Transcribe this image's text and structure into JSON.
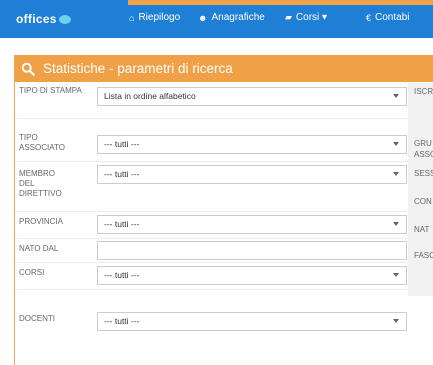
{
  "brand": {
    "text": "offices"
  },
  "nav": [
    {
      "icon": "home-icon",
      "label": "Riepilogo",
      "glyph": "⌂"
    },
    {
      "icon": "users-icon",
      "label": "Anagrafiche",
      "glyph": "☻"
    },
    {
      "icon": "book-icon",
      "label": "Corsi ▾",
      "glyph": "▰"
    },
    {
      "icon": "euro-icon",
      "label": "Contabi",
      "glyph": "€"
    }
  ],
  "panel": {
    "title": "Statistiche - parametri di ricerca"
  },
  "form": {
    "tipo_stampa": {
      "label": "TIPO DI STAMPA",
      "value": "Lista in ordine alfabetico"
    },
    "tipo_associato": {
      "label": "TIPO ASSOCIATO",
      "value": "--- tutti ---"
    },
    "membro_direttivo": {
      "label": "MEMBRO DEL DIRETTIVO",
      "value": "--- tutti ---"
    },
    "provincia": {
      "label": "PROVINCIA",
      "value": "--- tutti ---"
    },
    "nato_dal": {
      "label": "NATO DAL",
      "value": ""
    },
    "corsi": {
      "label": "CORSI",
      "value": "--- tutti ---"
    },
    "docenti": {
      "label": "DOCENTI",
      "value": "--- tutti ---"
    }
  },
  "right_labels": [
    "ISCR",
    "GRU",
    "ASSO",
    "SESS",
    "CON",
    "NAT",
    "FASC"
  ]
}
